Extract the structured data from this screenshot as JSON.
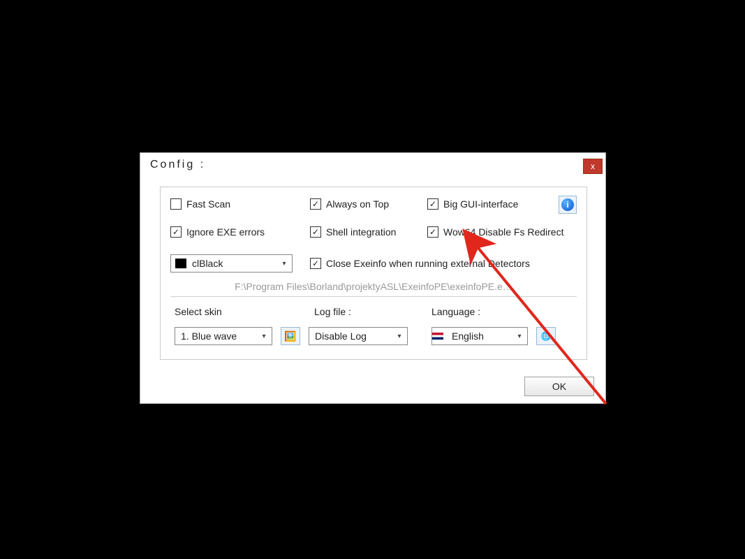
{
  "dialog": {
    "title": "Config :",
    "close": "x"
  },
  "checkboxes": {
    "fast_scan": {
      "label": "Fast Scan",
      "checked": false
    },
    "always_on_top": {
      "label": "Always on Top",
      "checked": true
    },
    "big_gui": {
      "label": "Big GUI-interface",
      "checked": true
    },
    "ignore_exe": {
      "label": "Ignore EXE errors",
      "checked": true
    },
    "shell_int": {
      "label": "Shell integration",
      "checked": true
    },
    "wow64": {
      "label": "Wow64 Disable Fs Redirect",
      "checked": true
    },
    "close_exeinfo": {
      "label": "Close Exeinfo when running external Detectors",
      "checked": true
    }
  },
  "color_combo": {
    "value": "clBlack"
  },
  "path": "F:\\Program Files\\Borland\\projektyASL\\ExeinfoPE\\exeinfoPE.e…",
  "labels": {
    "select_skin": "Select skin",
    "log_file": "Log file :",
    "language": "Language :"
  },
  "skin_combo": {
    "value": "1. Blue wave"
  },
  "log_combo": {
    "value": "Disable Log"
  },
  "lang_combo": {
    "value": "English"
  },
  "ok": "OK",
  "icons": {
    "info": "i"
  }
}
